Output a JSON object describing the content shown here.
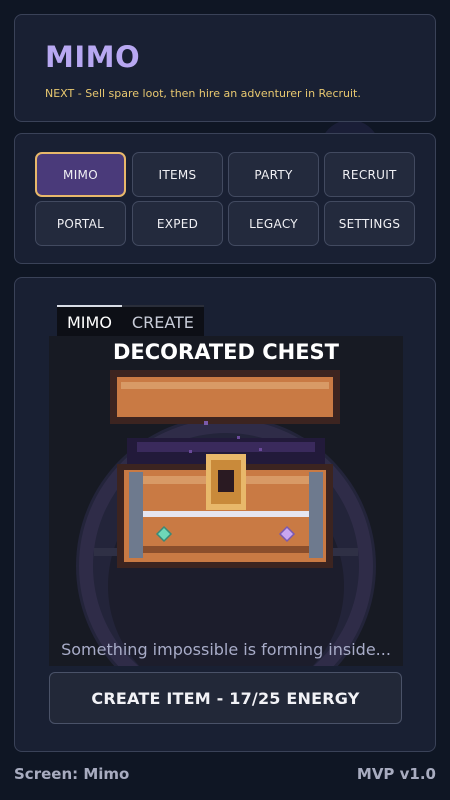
{
  "header": {
    "title": "MIMO",
    "next_hint": "NEXT - Sell spare loot, then hire an adventurer in Recruit."
  },
  "nav": {
    "buttons": [
      "MIMO",
      "ITEMS",
      "PARTY",
      "RECRUIT",
      "PORTAL",
      "EXPED",
      "LEGACY",
      "SETTINGS"
    ],
    "active": "MIMO"
  },
  "main": {
    "tabs": [
      "MIMO",
      "CREATE"
    ],
    "active_tab": "MIMO",
    "item_name": "DECORATED CHEST",
    "forming_text": "Something impossible is forming inside...",
    "create_button": "CREATE ITEM - 17/25 ENERGY",
    "energy": {
      "current": 17,
      "max": 25
    }
  },
  "footer": {
    "screen_label": "Screen: Mimo",
    "version": "MVP v1.0"
  },
  "colors": {
    "background": "#0f1624",
    "panel": "#192033",
    "title": "#b8a8f2",
    "hint": "#e8c870",
    "active_nav_bg": "#4a3a7a",
    "active_nav_border": "#e8b86a",
    "chest_wood": "#c97a44",
    "chest_lock": "#e8b86a"
  },
  "icons": {
    "chest": "treasure-chest-icon",
    "gem_left": "teal-gem-icon",
    "gem_right": "purple-gem-icon"
  }
}
